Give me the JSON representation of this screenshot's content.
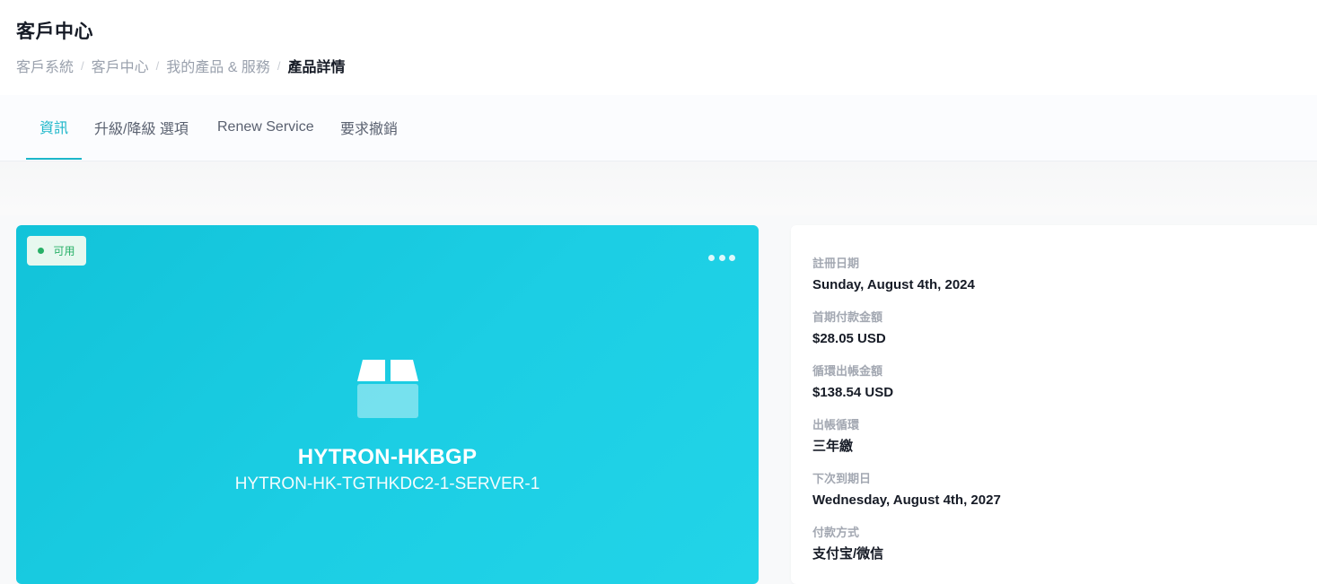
{
  "header": {
    "title": "客戶中心",
    "breadcrumb": [
      "客戶系統",
      "客戶中心",
      "我的產品 & 服務",
      "產品詳情"
    ]
  },
  "tabs": [
    {
      "label": "資訊",
      "active": true
    },
    {
      "label": "升級/降級 選項",
      "active": false
    },
    {
      "label": "Renew Service",
      "active": false
    },
    {
      "label": "要求撤銷",
      "active": false
    }
  ],
  "product": {
    "status": "可用",
    "name": "HYTRON-HKBGP",
    "domain": "HYTRON-HK-TGTHKDC2-1-SERVER-1",
    "icon": "box-icon",
    "card_color": "#1ccee4"
  },
  "details": [
    {
      "label": "註冊日期",
      "value": "Sunday, August 4th, 2024"
    },
    {
      "label": "首期付款金額",
      "value": "$28.05 USD"
    },
    {
      "label": "循環出帳金額",
      "value": "$138.54 USD"
    },
    {
      "label": "出帳循環",
      "value": "三年繳"
    },
    {
      "label": "下次到期日",
      "value": "Wednesday, August 4th, 2027"
    },
    {
      "label": "付款方式",
      "value": "支付宝/微信"
    }
  ],
  "colors": {
    "accent": "#1bb6c9",
    "status_green": "#27b067"
  }
}
